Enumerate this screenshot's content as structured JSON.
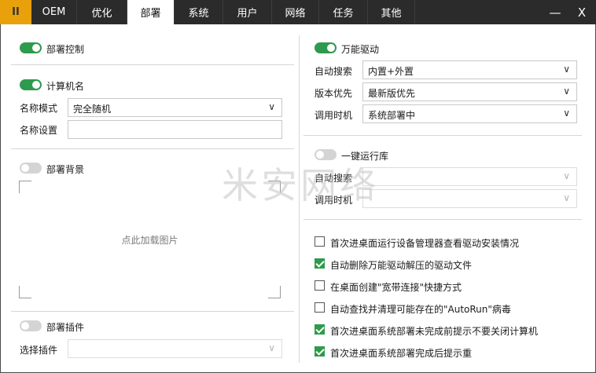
{
  "topbar": {
    "logo": "II",
    "tabs": [
      {
        "label": "OEM"
      },
      {
        "label": "优化"
      },
      {
        "label": "部署"
      },
      {
        "label": "系统"
      },
      {
        "label": "用户"
      },
      {
        "label": "网络"
      },
      {
        "label": "任务"
      },
      {
        "label": "其他"
      }
    ],
    "active_tab": "部署",
    "minimize_glyph": "—",
    "close_glyph": "X"
  },
  "left": {
    "deploy_control": {
      "label": "部署控制",
      "on": true
    },
    "computer_name": {
      "label": "计算机名",
      "on": true,
      "mode_label": "名称模式",
      "mode_value": "完全随机",
      "setting_label": "名称设置",
      "setting_value": ""
    },
    "background": {
      "label": "部署背景",
      "on": false,
      "placeholder": "点此加载图片"
    },
    "plugin": {
      "label": "部署插件",
      "on": false,
      "select_label": "选择插件",
      "select_value": ""
    }
  },
  "right": {
    "driver": {
      "label": "万能驱动",
      "on": true,
      "rows": [
        {
          "label": "自动搜索",
          "value": "内置+外置"
        },
        {
          "label": "版本优先",
          "value": "最新版优先"
        },
        {
          "label": "调用时机",
          "value": "系统部署中"
        }
      ]
    },
    "runtime": {
      "label": "一键运行库",
      "on": false,
      "rows": [
        {
          "label": "自动搜索",
          "value": ""
        },
        {
          "label": "调用时机",
          "value": ""
        }
      ]
    },
    "checkboxes": [
      {
        "label": "首次进桌面运行设备管理器查看驱动安装情况",
        "checked": false
      },
      {
        "label": "自动删除万能驱动解压的驱动文件",
        "checked": true
      },
      {
        "label": "在桌面创建\"宽带连接\"快捷方式",
        "checked": false
      },
      {
        "label": "自动查找并清理可能存在的\"AutoRun\"病毒",
        "checked": false
      },
      {
        "label": "首次进桌面系统部署未完成前提示不要关闭计算机",
        "checked": true
      },
      {
        "label": "首次进桌面系统部署完成后提示重",
        "checked": true
      }
    ]
  },
  "watermark": "米安网络",
  "colors": {
    "accent": "#2e9a4e",
    "logo": "#e8a10a",
    "topbar": "#2b2b2b"
  }
}
